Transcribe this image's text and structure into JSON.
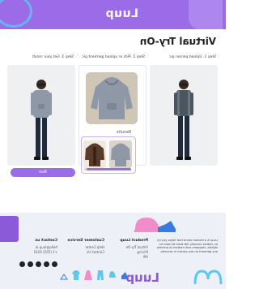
{
  "header": {
    "logo": "Luup"
  },
  "page": {
    "title": "Virtual Try-On"
  },
  "steps": [
    {
      "label": "Step 1. Upload person pic"
    },
    {
      "label": "Step 2. Pick or upload garment pic"
    },
    {
      "label": "Step 3. Get your result"
    }
  ],
  "result": {
    "hint": "Results",
    "progress": 0.95
  },
  "cta": {
    "label": "Run"
  },
  "footer": {
    "about": "Luup is a fashion brand that helps you try on clothes virtually. We build AI tools for stylists, shoppers and creators to preview any garment on any person in seconds.",
    "product_title": "Product Luup",
    "product_links": [
      "Virtual Try-On",
      "Pricing",
      "API"
    ],
    "support_title": "Customer Service",
    "support_links": [
      "Help Center",
      "Contact Us"
    ],
    "contact_title": "Contact us",
    "contact_lines": [
      "hello@luup.ai",
      "+1 (555) 0142"
    ],
    "bottom_logo": "Luup"
  },
  "colors": {
    "brand": "#9b6be8",
    "accent_blue": "#5ac8f0",
    "pink": "#f08cc8"
  }
}
